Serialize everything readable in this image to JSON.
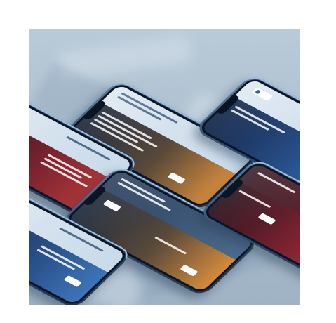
{
  "scene": {
    "description_label": "",
    "phones": [
      {
        "id": "phone-top-center",
        "screen_theme": "sunset"
      },
      {
        "id": "phone-top-right",
        "screen_theme": "blue"
      },
      {
        "id": "phone-left-upper",
        "screen_theme": "red"
      },
      {
        "id": "phone-center",
        "screen_theme": "sunset"
      },
      {
        "id": "phone-left-lower",
        "screen_theme": "blue"
      },
      {
        "id": "phone-right-lower",
        "screen_theme": "red"
      }
    ],
    "colors": {
      "background": "#b3c5d5",
      "phone_body": "#2f4e71",
      "brand_blue": "#1b4e9b"
    }
  }
}
